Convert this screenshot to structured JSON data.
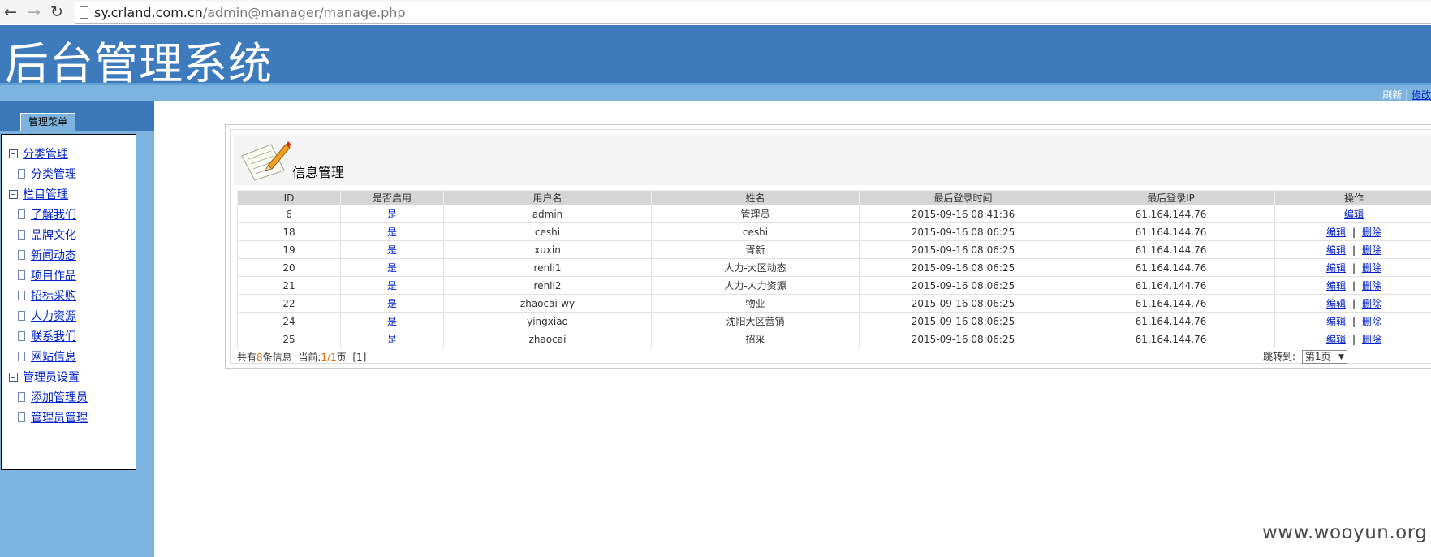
{
  "browser": {
    "back_icon": "arrow-left-icon",
    "forward_icon": "arrow-right-icon",
    "reload_icon": "reload-icon",
    "url_host": "sy.crland.com.cn",
    "url_path": "/admin@manager/manage.php"
  },
  "header": {
    "title": "后台管理系统"
  },
  "subbar": {
    "refresh_label": "刷新",
    "separator": "|",
    "edit_label": "修改"
  },
  "sidebar": {
    "tab_label": "管理菜单",
    "groups": [
      {
        "label": "分类管理",
        "items": [
          "分类管理"
        ]
      },
      {
        "label": "栏目管理",
        "items": [
          "了解我们",
          "品牌文化",
          "新闻动态",
          "项目作品",
          "招标采购",
          "人力资源",
          "联系我们",
          "网站信息"
        ]
      },
      {
        "label": "管理员设置",
        "items": [
          "添加管理员",
          "管理员管理"
        ]
      }
    ]
  },
  "panel": {
    "title": "信息管理",
    "icon": "notepad-pencil-icon",
    "columns": [
      "ID",
      "是否启用",
      "用户名",
      "姓名",
      "最后登录时间",
      "最后登录IP",
      "操作"
    ],
    "rows": [
      {
        "id": "6",
        "enabled": "是",
        "username": "admin",
        "name": "管理员",
        "last_login": "2015-09-16 08:41:36",
        "ip": "61.164.144.76",
        "ops": [
          "编辑"
        ]
      },
      {
        "id": "18",
        "enabled": "是",
        "username": "ceshi",
        "name": "ceshi",
        "last_login": "2015-09-16 08:06:25",
        "ip": "61.164.144.76",
        "ops": [
          "编辑",
          "删除"
        ]
      },
      {
        "id": "19",
        "enabled": "是",
        "username": "xuxin",
        "name": "胥新",
        "last_login": "2015-09-16 08:06:25",
        "ip": "61.164.144.76",
        "ops": [
          "编辑",
          "删除"
        ]
      },
      {
        "id": "20",
        "enabled": "是",
        "username": "renli1",
        "name": "人力-大区动态",
        "last_login": "2015-09-16 08:06:25",
        "ip": "61.164.144.76",
        "ops": [
          "编辑",
          "删除"
        ]
      },
      {
        "id": "21",
        "enabled": "是",
        "username": "renli2",
        "name": "人力-人力资源",
        "last_login": "2015-09-16 08:06:25",
        "ip": "61.164.144.76",
        "ops": [
          "编辑",
          "删除"
        ]
      },
      {
        "id": "22",
        "enabled": "是",
        "username": "zhaocai-wy",
        "name": "物业",
        "last_login": "2015-09-16 08:06:25",
        "ip": "61.164.144.76",
        "ops": [
          "编辑",
          "删除"
        ]
      },
      {
        "id": "24",
        "enabled": "是",
        "username": "yingxiao",
        "name": "沈阳大区营销",
        "last_login": "2015-09-16 08:06:25",
        "ip": "61.164.144.76",
        "ops": [
          "编辑",
          "删除"
        ]
      },
      {
        "id": "25",
        "enabled": "是",
        "username": "zhaocai",
        "name": "招采",
        "last_login": "2015-09-16 08:06:25",
        "ip": "61.164.144.76",
        "ops": [
          "编辑",
          "删除"
        ]
      }
    ],
    "op_separator": "|",
    "footer": {
      "total_prefix": "共有",
      "total_count": "8",
      "total_suffix": "条信息",
      "current_prefix": "当前:",
      "current_page": "1/1",
      "current_suffix": "页",
      "page_links": "[1]",
      "jump_label": "跳转到:",
      "jump_selected": "第1页"
    }
  },
  "watermark": "www.wooyun.org"
}
